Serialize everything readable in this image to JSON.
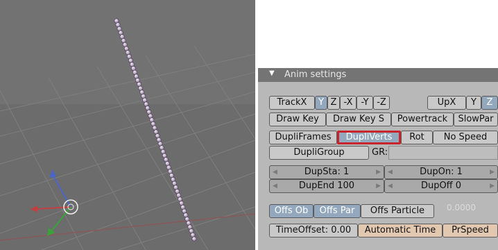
{
  "panel": {
    "title": "Anim settings",
    "track": {
      "label": "TrackX",
      "y": "Y",
      "z": "Z",
      "nx": "-X",
      "ny": "-Y",
      "nz": "-Z"
    },
    "up": {
      "label": "UpX",
      "y": "Y",
      "z": "Z"
    },
    "drawkey": {
      "draw_key": "Draw Key",
      "draw_key_s": "Draw Key S",
      "powertrack": "Powertrack",
      "slowpar": "SlowPar"
    },
    "dupli": {
      "frames": "DupliFrames",
      "verts": "DupliVerts",
      "rot": "Rot",
      "no_speed": "No Speed"
    },
    "group": {
      "label": "DupliGroup",
      "gr": "GR:"
    },
    "numbers": {
      "dupsta": "DupSta: 1",
      "dupon": "DupOn: 1",
      "dupend": "DupEnd 100",
      "dupoff": "DupOff 0"
    },
    "offs": {
      "ob": "Offs Ob",
      "par": "Offs Par",
      "particle": "Offs Particle",
      "value": "0.0000"
    },
    "time": {
      "offset": "TimeOffset: 0.00",
      "automatic": "Automatic Time",
      "prspeed": "PrSpeed"
    }
  },
  "colors": {
    "active": "#93a8bd",
    "highlight": "#c8242b",
    "vertex": "#e3d2ea"
  }
}
